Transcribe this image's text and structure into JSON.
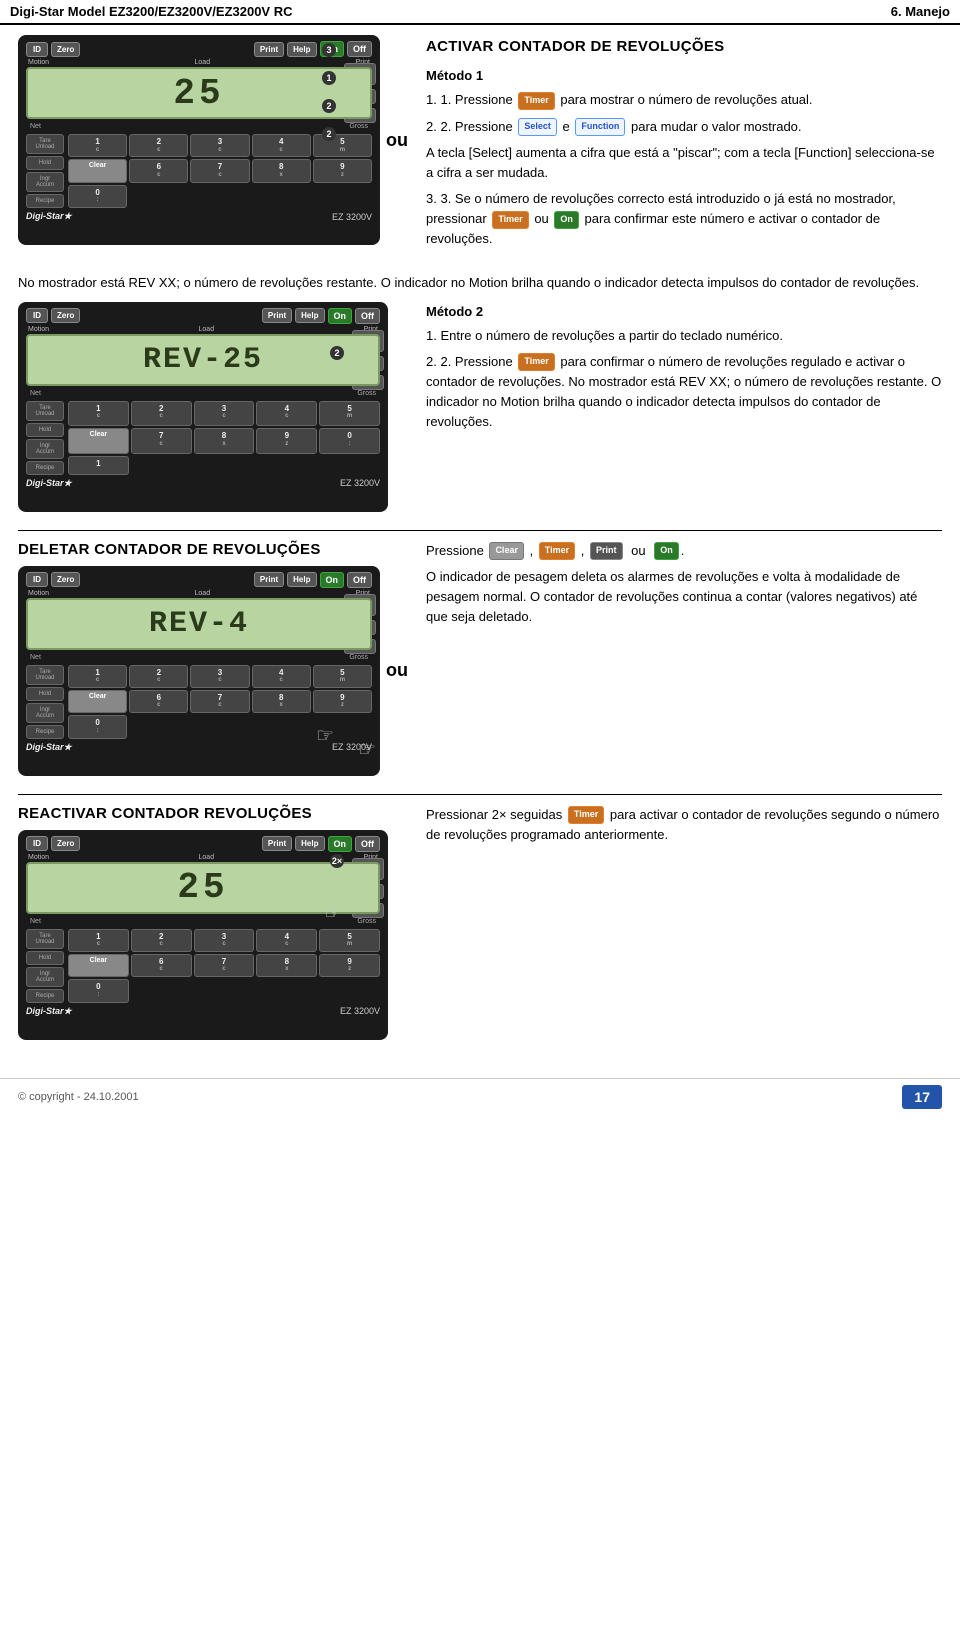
{
  "header": {
    "title": "Digi-Star Model EZ3200/EZ3200V/EZ3200V RC",
    "section": "6. Manejo"
  },
  "section1": {
    "heading": "ACTIVAR CONTADOR DE REVOLUÇÕES",
    "display_value": "25",
    "metodo1_title": "Método 1",
    "metodo1_p1": "1. Pressione",
    "metodo1_p1b": "para mostrar o número de revoluções atual.",
    "metodo1_p2_pre": "2. Pressione",
    "metodo1_p2_mid": "e",
    "metodo1_p2_post": "para mudar o valor mostrado.",
    "metodo1_p3": "A tecla [Select] aumenta a cifra que está a \"piscar\"; com a tecla [Function] selecciona-se a cifra a ser mudada.",
    "step3_pre": "3. Se o número de revoluções correcto está introduzido o já está no mostrador, pressionar",
    "step3_mid": "ou",
    "step3_post": "para confirmar este número e activar o contador de revoluções.",
    "full_text1": "No mostrador está REV XX; o número de revoluções restante. O indicador no Motion brilha quando o indicador detecta impulsos do contador de revoluções."
  },
  "section2": {
    "display_value": "REV-25",
    "metodo2_title": "Método 2",
    "metodo2_p1": "1. Entre o número de revoluções a partir do teclado numérico.",
    "metodo2_p2_pre": "2. Pressione",
    "metodo2_p2_post": "para confirmar o número de revoluções regulado e activar o contador de revoluções. No mostrador está REV XX; o número de revoluções restante. O indicador no Motion brilha quando o indicador detecta impulsos do contador de revoluções."
  },
  "section3": {
    "heading": "DELETAR CONTADOR DE REVOLUÇÕES",
    "display_value": "REV-4",
    "pressione_pre": "Pressione",
    "ou_label": "ou",
    "text": "O indicador de pesagem deleta os alarmes de revoluções e volta à modalidade de pesagem normal. O contador de revoluções continua a contar (valores negativos) até que seja deletado."
  },
  "section4": {
    "heading": "REACTIVAR CONTADOR REVOLUÇÕES",
    "display_value": "25",
    "pressionar_pre": "Pressionar 2×  seguidas",
    "pressionar_post": "para activar o contador de revoluções segundo o número de revoluções programado anteriormente."
  },
  "footer": {
    "copyright": "© copyright - 24.10.2001",
    "page_number": "17"
  },
  "buttons": {
    "timer": "Timer",
    "select": "Select",
    "function": "Function",
    "on": "On",
    "off": "Off",
    "clear": "Clear",
    "print": "Print",
    "id": "ID",
    "zero": "Zero",
    "help": "Help"
  },
  "device": {
    "logo": "Digi-Star★",
    "model": "EZ 3200V",
    "labels": {
      "motion": "Motion",
      "load": "Load",
      "print": "Print",
      "net": "Net",
      "gross": "Gross",
      "tare": "Tare",
      "unload": "Unload",
      "hold": "Hold",
      "ingr": "Ingr",
      "accum": "Accum",
      "recipe": "Recipe"
    },
    "numkeys": [
      "1",
      "2",
      "3",
      "4",
      "5",
      "6",
      "7",
      "8",
      "9",
      "0"
    ],
    "clear_label": "Clear"
  }
}
